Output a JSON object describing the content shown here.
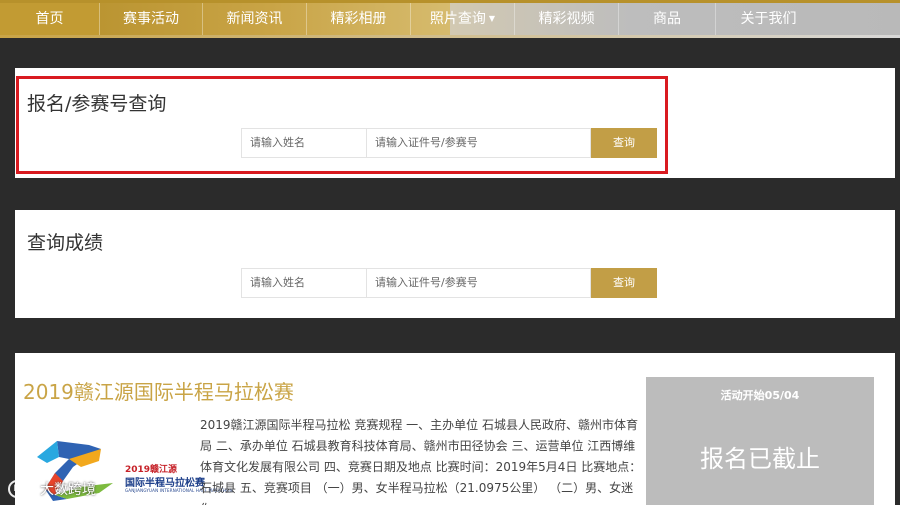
{
  "nav": {
    "items": [
      {
        "label": "首页",
        "active": true
      },
      {
        "label": "赛事活动"
      },
      {
        "label": "新闻资讯"
      },
      {
        "label": "精彩相册"
      },
      {
        "label": "照片查询"
      },
      {
        "label": "精彩视频"
      },
      {
        "label": "商品"
      },
      {
        "label": "关于我们"
      }
    ],
    "dropdown_caret": "▼"
  },
  "registration": {
    "title": "报名/参赛号查询",
    "name_placeholder": "请输入姓名",
    "id_placeholder": "请输入证件号/参赛号",
    "button": "查询"
  },
  "results": {
    "title": "查询成绩",
    "name_placeholder": "请输入姓名",
    "id_placeholder": "请输入证件号/参赛号",
    "button": "查询"
  },
  "event": {
    "title": "2019赣江源国际半程马拉松赛",
    "description": "2019赣江源国际半程马拉松 竞赛规程 一、主办单位 石城县人民政府、赣州市体育局 二、承办单位 石城县教育科技体育局、赣州市田径协会 三、运营单位 江西博维体育文化发展有限公司 四、竞赛日期及地点 比赛时间：2019年5月4日 比赛地点：石城县 五、竞赛项目 （一）男、女半程马拉松（21.0975公里） （二）男、女迷你",
    "logo": {
      "title": "2019赣江源",
      "name": "国际半程马拉松赛",
      "en": "GANJIANGYUAN INTERNATIONAL HALF MARATHON"
    },
    "status_card": {
      "date": "活动开始05/04",
      "status": "报名已截止"
    }
  },
  "watermark": {
    "icon": "K",
    "text": "大数跨境"
  }
}
